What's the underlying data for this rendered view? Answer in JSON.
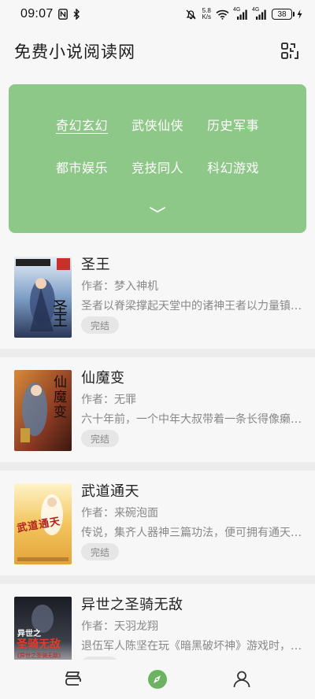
{
  "status_bar": {
    "time": "09:07",
    "net_speed_value": "5.8",
    "net_speed_unit": "K/s",
    "signal_1": "4G",
    "signal_2": "4G",
    "battery": "38"
  },
  "header": {
    "title": "免费小说阅读网",
    "qr_icon": "qr-scan-icon"
  },
  "categories": {
    "items": [
      {
        "label": "奇幻玄幻",
        "active": true
      },
      {
        "label": "武侠仙侠",
        "active": false
      },
      {
        "label": "历史军事",
        "active": false
      },
      {
        "label": "都市娱乐",
        "active": false
      },
      {
        "label": "竞技同人",
        "active": false
      },
      {
        "label": "科幻游戏",
        "active": false
      }
    ],
    "card_color": "#8ec888"
  },
  "books": [
    {
      "title": "圣王",
      "author": "作者：梦入神机",
      "desc": "圣者以脊梁撑起天堂中的诸神王者以力量镇压...",
      "status": "完结"
    },
    {
      "title": "仙魔变",
      "author": "作者：无罪",
      "desc": "六十年前，一个中年大叔带着一条长得像癞皮狗...",
      "status": "完结"
    },
    {
      "title": "武道通天",
      "author": "作者：来碗泡面",
      "desc": "传说，集齐人器神三篇功法，便可拥有通天之能...",
      "status": "完结"
    },
    {
      "title": "异世之圣骑无敌",
      "author": "作者：天羽龙翔",
      "desc": "退伍军人陈坚在玩《暗黑破坏神》游戏时，意外...",
      "status": "完结"
    }
  ],
  "covers": {
    "cover_1_text": "圣王",
    "cover_2_text": "仙魔变",
    "cover_3_text": "武道通天",
    "cover_4_top": "异世之",
    "cover_4_main": "圣骑无敌",
    "cover_4_bottom": "《异世之圣骑无敌》"
  },
  "bottom_nav": [
    {
      "icon": "bookshelf-icon"
    },
    {
      "icon": "discover-compass-icon"
    },
    {
      "icon": "profile-icon"
    }
  ]
}
